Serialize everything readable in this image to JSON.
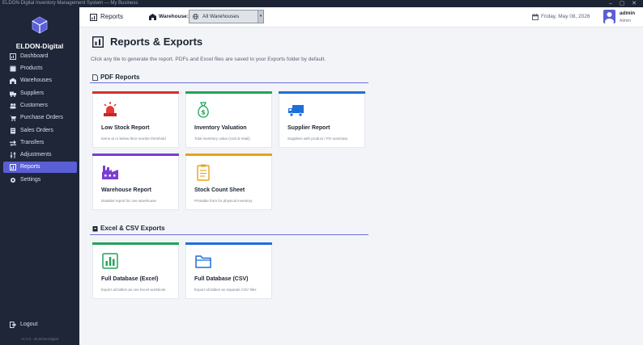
{
  "window": {
    "title": "ELDON-Digital Inventory Management System — My Business",
    "controls": [
      "–",
      "▢",
      "✕"
    ]
  },
  "sidebar": {
    "brand": "ELDON-Digital",
    "items": [
      {
        "label": "Dashboard",
        "icon": "dashboard-icon"
      },
      {
        "label": "Products",
        "icon": "box-icon"
      },
      {
        "label": "Warehouses",
        "icon": "warehouse-icon"
      },
      {
        "label": "Suppliers",
        "icon": "truck-icon"
      },
      {
        "label": "Customers",
        "icon": "users-icon"
      },
      {
        "label": "Purchase Orders",
        "icon": "cart-icon"
      },
      {
        "label": "Sales Orders",
        "icon": "receipt-icon"
      },
      {
        "label": "Transfers",
        "icon": "transfer-icon"
      },
      {
        "label": "Adjustments",
        "icon": "sliders-icon"
      },
      {
        "label": "Reports",
        "icon": "report-icon",
        "active": true
      },
      {
        "label": "Settings",
        "icon": "gear-icon"
      }
    ],
    "logout": "Logout",
    "version": "v1.0.0 · ELDON-Digital"
  },
  "topbar": {
    "title": "Reports",
    "warehouse_label": "Warehouse:",
    "warehouse_value": "All Warehouses",
    "date": "Friday, May 08, 2026",
    "user_name": "admin",
    "user_role": "Admin"
  },
  "page": {
    "title": "Reports & Exports",
    "subtitle": "Click any tile to generate the report. PDFs and Excel files are saved to your Exports folder by default."
  },
  "sections": {
    "pdf": {
      "title": "PDF Reports",
      "cards": [
        {
          "title": "Low Stock Report",
          "desc": "Items at or below their reorder threshold",
          "accent": "#d32f2f",
          "icon": "alarm-icon"
        },
        {
          "title": "Inventory Valuation",
          "desc": "Total inventory value (cost & retail)",
          "accent": "#22a45a",
          "icon": "money-bag-icon"
        },
        {
          "title": "Supplier Report",
          "desc": "Suppliers with product / PO summary",
          "accent": "#1e6fd9",
          "icon": "delivery-truck-icon"
        },
        {
          "title": "Warehouse Report",
          "desc": "Detailed report for one warehouse",
          "accent": "#7a3fd0",
          "icon": "factory-icon"
        },
        {
          "title": "Stock Count Sheet",
          "desc": "Printable form for physical inventory",
          "accent": "#e8a317",
          "icon": "clipboard-icon"
        }
      ]
    },
    "excel": {
      "title": "Excel & CSV Exports",
      "cards": [
        {
          "title": "Full Database (Excel)",
          "desc": "Export all tables as one Excel workbook",
          "accent": "#22a45a",
          "icon": "spreadsheet-chart-icon"
        },
        {
          "title": "Full Database (CSV)",
          "desc": "Export all tables as separate CSV files",
          "accent": "#1e6fd9",
          "icon": "folder-icon"
        }
      ]
    }
  }
}
